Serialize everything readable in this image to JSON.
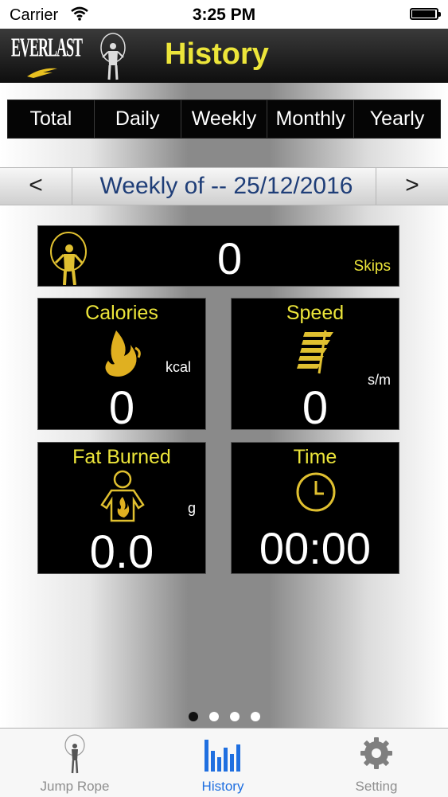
{
  "status_bar": {
    "carrier": "Carrier",
    "time": "3:25 PM",
    "battery_level": 0.95
  },
  "header": {
    "logo_text": "EVERLAST",
    "title": "History"
  },
  "period_tabs": [
    "Total",
    "Daily",
    "Weekly",
    "Monthly",
    "Yearly"
  ],
  "date_nav": {
    "prev": "<",
    "label": "Weekly of -- 25/12/2016",
    "next": ">"
  },
  "skips": {
    "value": "0",
    "unit": "Skips"
  },
  "cards": {
    "calories": {
      "title": "Calories",
      "unit": "kcal",
      "value": "0"
    },
    "speed": {
      "title": "Speed",
      "unit": "s/m",
      "value": "0"
    },
    "fat": {
      "title": "Fat Burned",
      "unit": "g",
      "value": "0.0"
    },
    "time": {
      "title": "Time",
      "value": "00:00"
    }
  },
  "page_indicator": {
    "count": 4,
    "active": 1
  },
  "tabbar": {
    "items": [
      {
        "label": "Jump Rope",
        "icon": "jump-rope-icon"
      },
      {
        "label": "History",
        "icon": "bar-chart-icon"
      },
      {
        "label": "Setting",
        "icon": "gear-icon"
      }
    ]
  },
  "colors": {
    "accent_yellow": "#ece53a",
    "date_blue": "#1f3e78",
    "tab_active": "#1f6fe0"
  }
}
